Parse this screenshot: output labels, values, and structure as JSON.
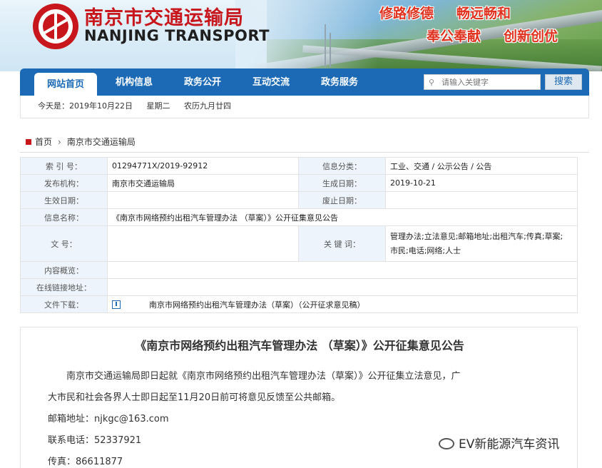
{
  "header": {
    "site_name_cn": "南京市交通运输局",
    "site_name_en": "NANJING TRANSPORT",
    "slogans": [
      "修路修德",
      "畅远畅和",
      "奉公奉献",
      "创新创优"
    ]
  },
  "nav": {
    "items": [
      {
        "label": "网站首页",
        "active": true
      },
      {
        "label": "机构信息"
      },
      {
        "label": "政务公开"
      },
      {
        "label": "互动交流"
      },
      {
        "label": "政务服务"
      }
    ],
    "search_placeholder": "请输入关键字",
    "search_button": "搜索"
  },
  "datebar": {
    "today": "今天是：2019年10月22日",
    "weekday": "星期二",
    "lunar": "农历九月廿四"
  },
  "breadcrumb": {
    "home": "首页",
    "current": "南京市交通运输局"
  },
  "info": {
    "index_label": "索 引 号：",
    "index_value": "01294771X/2019-92912",
    "category_label": "信息分类：",
    "category_value": "工业、交通 / 公示公告 / 公告",
    "publisher_label": "发布机构：",
    "publisher_value": "南京市交通运输局",
    "generated_label": "生成日期：",
    "generated_value": "2019-10-21",
    "effective_label": "生效日期：",
    "effective_value": "",
    "expire_label": "废止日期：",
    "expire_value": "",
    "name_label": "信息名称：",
    "name_value": "《南京市网络预约出租汽车管理办法 （草案）》公开征集意见公告",
    "docno_label": "文 号：",
    "docno_value": "",
    "keywords_label": "关 键 词：",
    "keywords_line1": "管理办法;立法意见;邮箱地址;出租汽车;传真;草案;",
    "keywords_line2": "市民;电话;网络;人士",
    "summary_label": "内容概览：",
    "summary_value": "",
    "link_label": "在线链接地址：",
    "link_value": "",
    "download_label": "文件下载：",
    "download_value": "南京市网络预约出租汽车管理办法（草案）（公开征求意见稿）"
  },
  "article": {
    "title": "《南京市网络预约出租汽车管理办法 （草案）》公开征集意见公告",
    "p1_line1": "南京市交通运输局即日起就《南京市网络预约出租汽车管理办法（草案）》公开征集立法意见，广",
    "p1_line2": "大市民和社会各界人士即日起至11月20日前可将意见反馈至公共邮箱。",
    "email": "邮箱地址：njkgc@163.com",
    "phone": "联系电话：52337921",
    "fax": "传真：86611877"
  },
  "watermark": "EV新能源汽车资讯"
}
